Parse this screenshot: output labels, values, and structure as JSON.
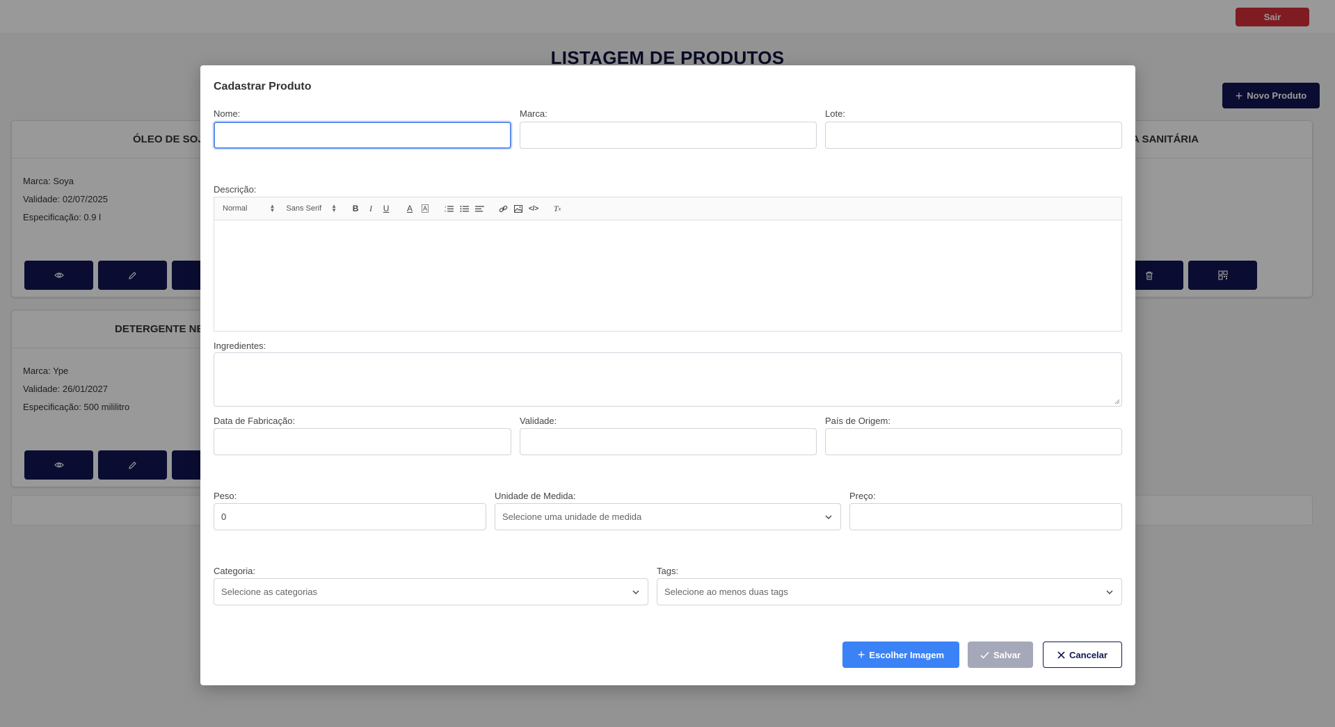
{
  "header": {
    "logout_label": "Sair"
  },
  "page": {
    "title": "LISTAGEM DE PRODUTOS",
    "new_product_label": "Novo Produto"
  },
  "cards": [
    {
      "title": "ÓLEO DE SOJ",
      "brand": "Marca: Soya",
      "validity": "Validade: 02/07/2025",
      "spec": "Especificação: 0.9 l"
    },
    {
      "title": "DETERGENTE NEU",
      "brand": "Marca: Ype",
      "validity": "Validade: 26/01/2027",
      "spec": "Especificação: 500 mililitro"
    },
    {
      "title": "A SANITÁRIA"
    }
  ],
  "modal": {
    "title": "Cadastrar Produto",
    "labels": {
      "name": "Nome:",
      "brand": "Marca:",
      "lot": "Lote:",
      "description": "Descrição:",
      "ingredients": "Ingredientes:",
      "manufacture_date": "Data de Fabricação:",
      "validity": "Validade:",
      "origin_country": "País de Origem:",
      "weight": "Peso:",
      "unit": "Unidade de Medida:",
      "price": "Preço:",
      "category": "Categoria:",
      "tags": "Tags:"
    },
    "values": {
      "weight": "0"
    },
    "placeholders": {
      "unit": "Selecione uma unidade de medida",
      "category": "Selecione as categorias",
      "tags": "Selecione ao menos duas tags"
    },
    "editor_toolbar": {
      "header_select": "Normal",
      "font_select": "Sans Serif"
    },
    "buttons": {
      "choose_image": "Escolher Imagem",
      "save": "Salvar",
      "cancel": "Cancelar"
    }
  }
}
